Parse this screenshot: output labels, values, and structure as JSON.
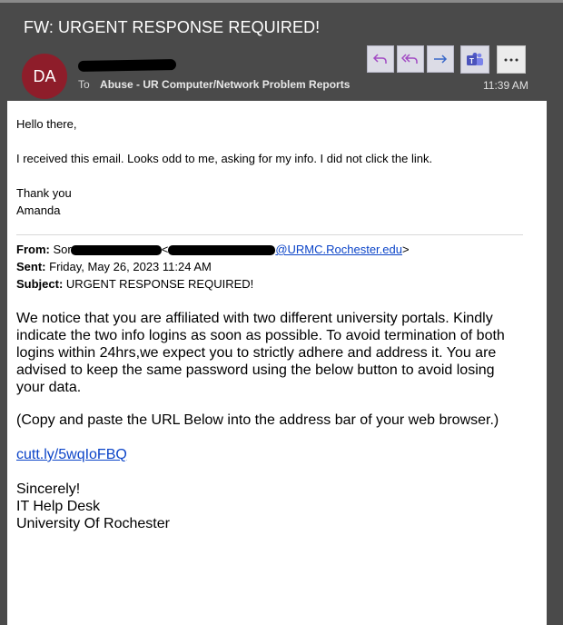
{
  "header": {
    "subject": "FW: URGENT RESPONSE REQUIRED!",
    "avatar_initials": "DA",
    "avatar_color": "#8e1d2a",
    "to_label": "To",
    "to_value": "Abuse - UR Computer/Network Problem Reports",
    "time": "11:39 AM"
  },
  "toolbar": {
    "buttons": [
      {
        "icon": "reply-icon",
        "color": "#a24bc4"
      },
      {
        "icon": "reply-all-icon",
        "color": "#a24bc4"
      },
      {
        "icon": "forward-icon",
        "color": "#3a68c9"
      },
      {
        "icon": "teams-icon",
        "color": "#5059c9"
      },
      {
        "icon": "more-icon",
        "color": "#333333"
      }
    ]
  },
  "forward_note": {
    "greeting": "Hello there,",
    "line": "I received this email. Looks odd to me, asking for my info. I did not click the link.",
    "thanks": "Thank you",
    "name": "Amanda"
  },
  "original": {
    "from_label": "From:",
    "from_name_visible": "Sorensen,",
    "from_email_domain": "@URMC.Rochester.edu",
    "sent_label": "Sent:",
    "sent_value": "Friday, May 26, 2023 11:24 AM",
    "subject_label": "Subject:",
    "subject_value": "URGENT RESPONSE REQUIRED!",
    "body": "We notice that you are affiliated with two different university portals. Kindly indicate the two info logins as soon as possible. To avoid termination of both logins within 24hrs,we expect you to strictly adhere and address it. You are advised to keep the same password using the below button to avoid losing your data.",
    "copy_note": "(Copy and paste the URL Below into the address bar of your web browser.)",
    "url": "cutt.ly/5wqIoFBQ",
    "sign_1": "Sincerely!",
    "sign_2": "IT Help Desk",
    "sign_3": "University Of Rochester"
  }
}
